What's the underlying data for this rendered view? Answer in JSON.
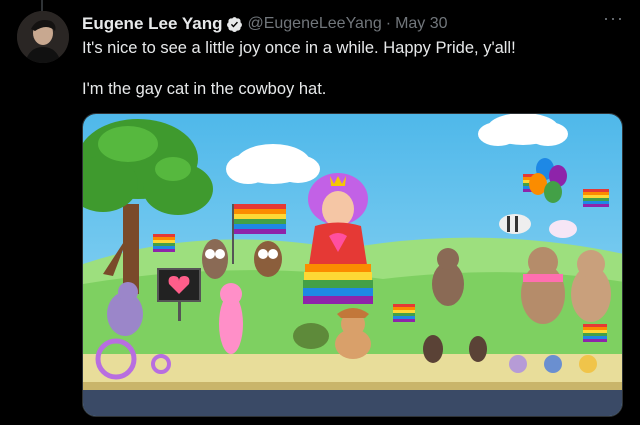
{
  "tweet": {
    "author_name": "Eugene Lee Yang",
    "handle": "@EugeneLeeYang",
    "separator": "·",
    "date": "May 30",
    "text_line1": "It's nice to see a little joy once in a while. Happy Pride, y'all!",
    "text_line2": "I'm the gay cat in the cowboy hat.",
    "more_label": "···"
  },
  "icons": {
    "verified": "verified-badge-icon",
    "more": "more-options-icon"
  },
  "colors": {
    "background": "#000000",
    "text_primary": "#e7e9ea",
    "text_secondary": "#71767b",
    "verified_blue": "#1d9bf0",
    "sky": "#6ec6ee",
    "grass": "#7ed061",
    "sidewalk": "#e8dd9a"
  }
}
